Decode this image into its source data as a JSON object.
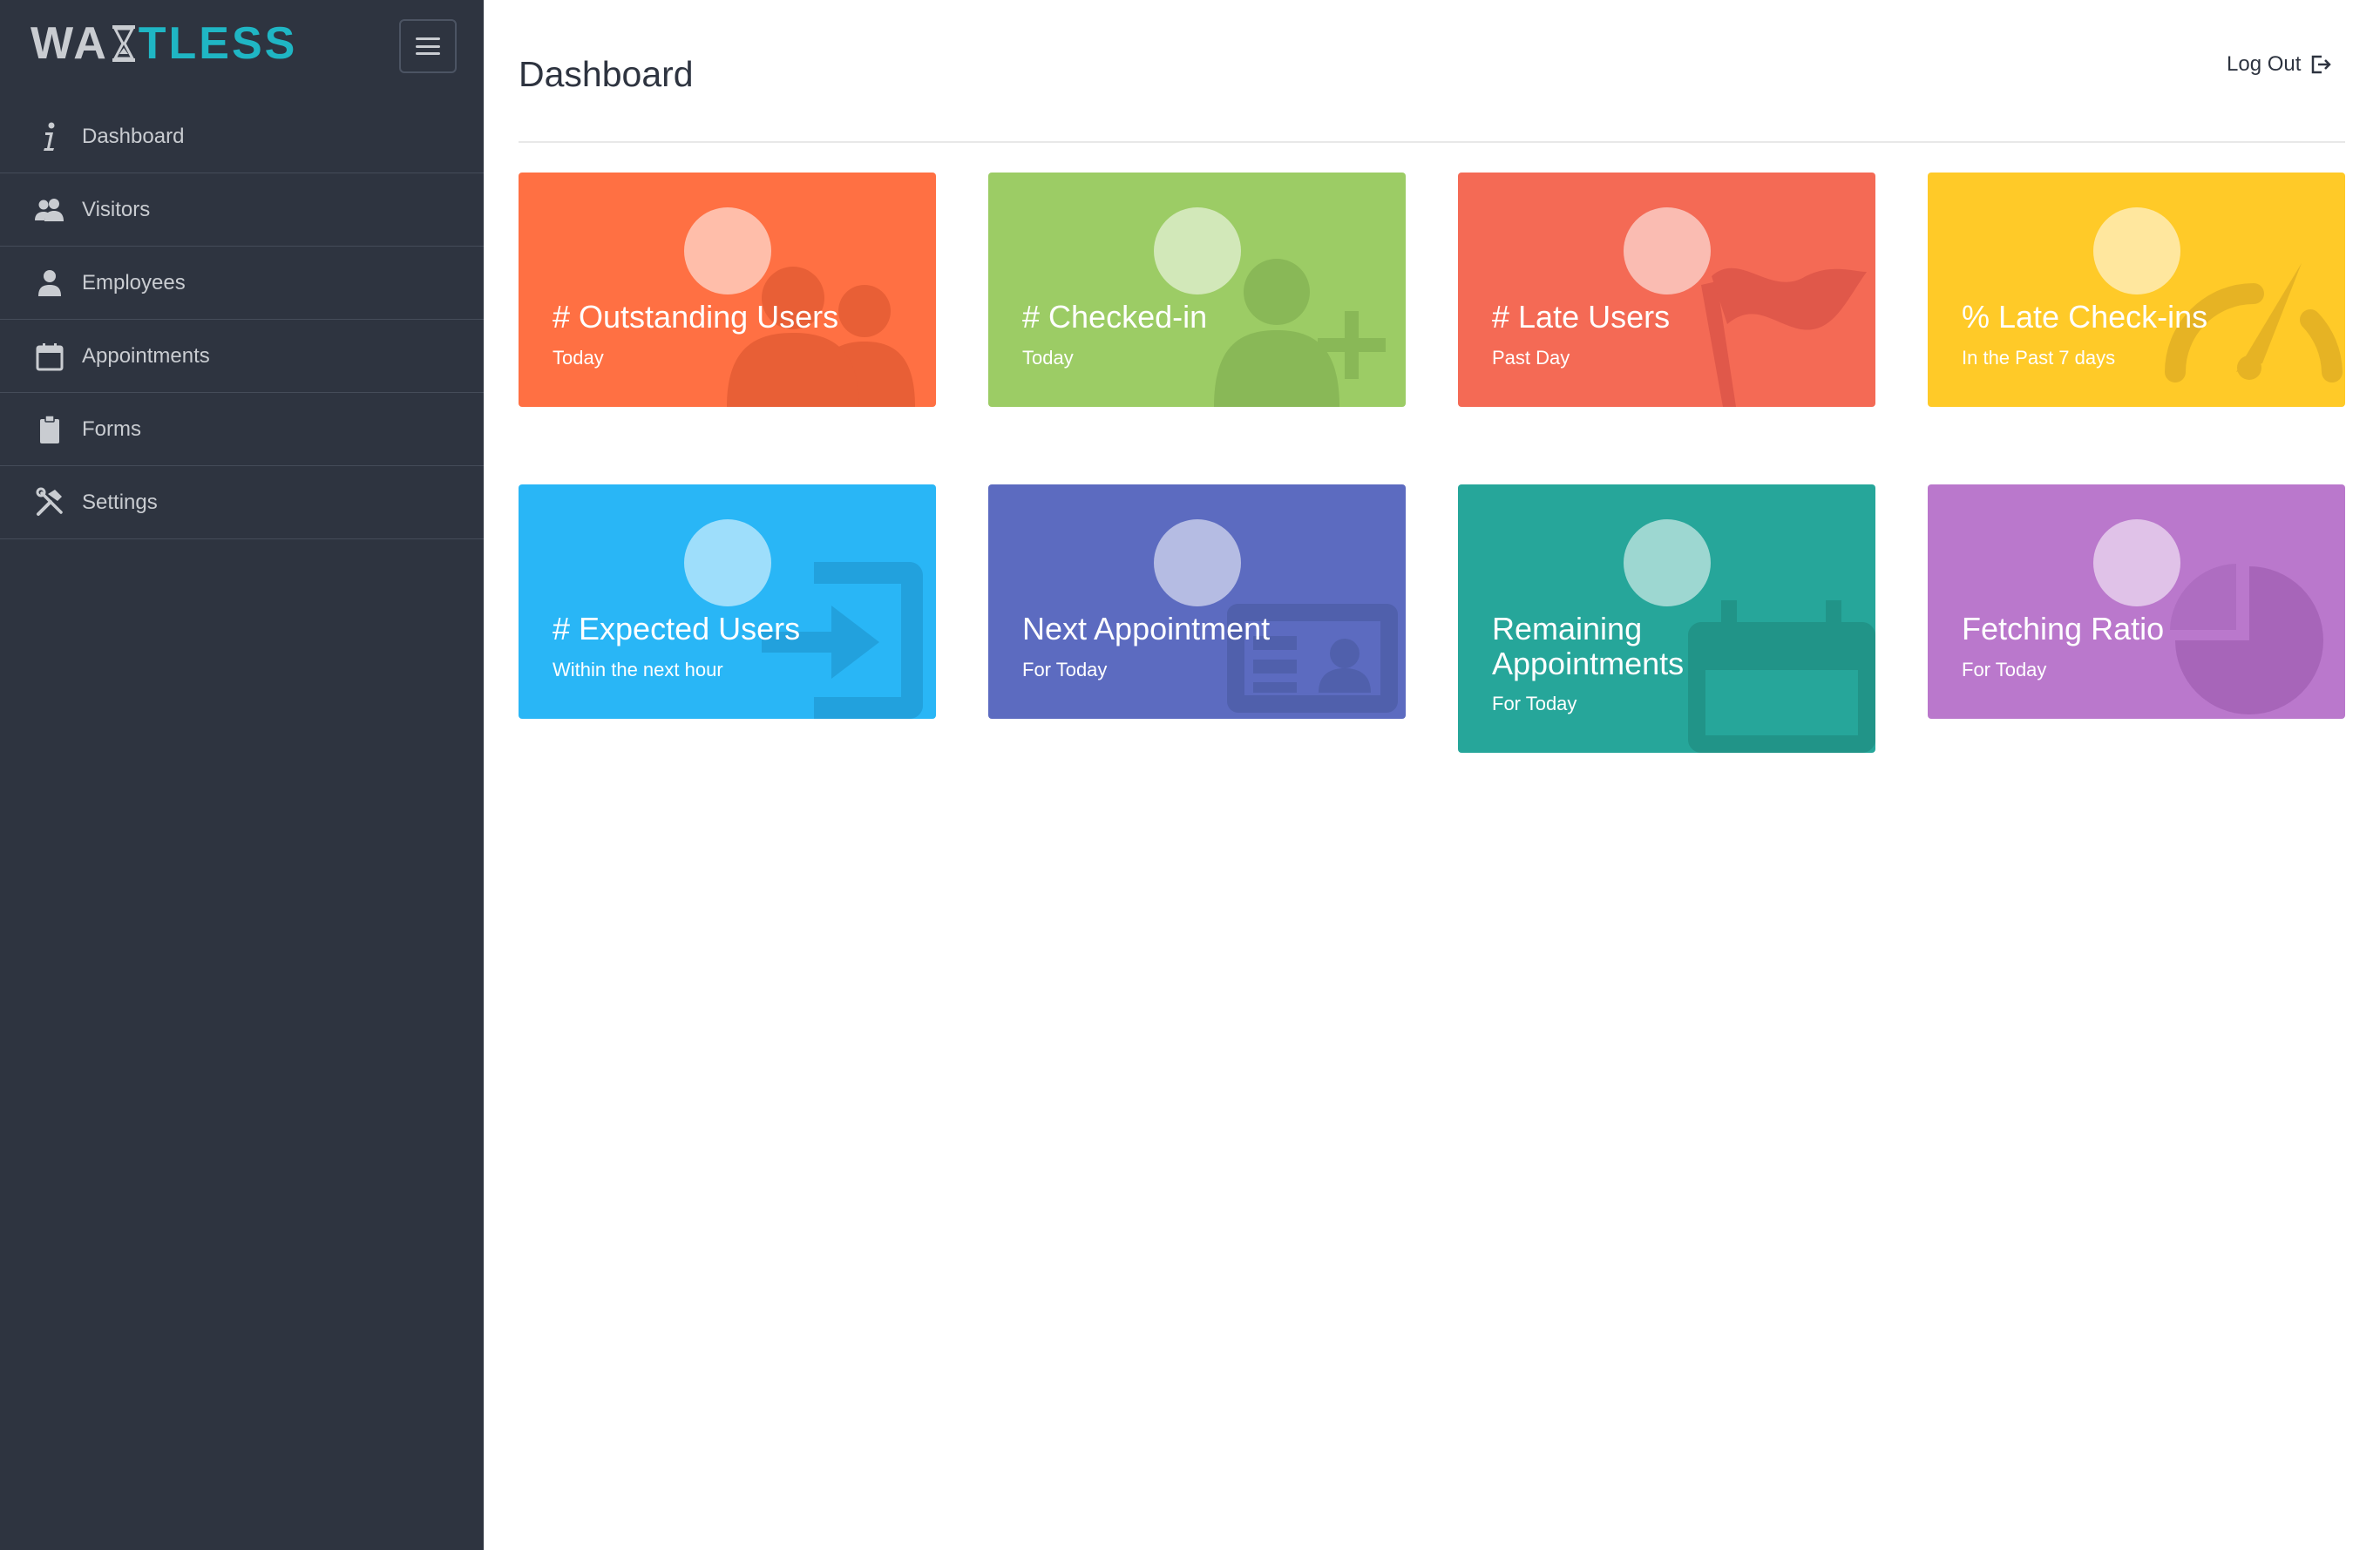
{
  "app": {
    "logo_part1": "WA",
    "logo_part2": "TLESS"
  },
  "sidebar": {
    "items": [
      {
        "label": "Dashboard",
        "icon": "info-icon"
      },
      {
        "label": "Visitors",
        "icon": "users-icon"
      },
      {
        "label": "Employees",
        "icon": "user-icon"
      },
      {
        "label": "Appointments",
        "icon": "calendar-icon"
      },
      {
        "label": "Forms",
        "icon": "clipboard-icon"
      },
      {
        "label": "Settings",
        "icon": "tools-icon"
      }
    ]
  },
  "header": {
    "title": "Dashboard",
    "logout_label": "Log Out"
  },
  "cards": [
    {
      "title": "# Outstanding Users",
      "subtitle": "Today",
      "color": "#ff7043",
      "icon": "users-silhouette-icon"
    },
    {
      "title": "# Checked-in",
      "subtitle": "Today",
      "color": "#9ccc65",
      "icon": "user-add-icon"
    },
    {
      "title": "# Late Users",
      "subtitle": "Past Day",
      "color": "#f46a55",
      "icon": "flag-icon"
    },
    {
      "title": "% Late Check-ins",
      "subtitle": "In the Past 7 days",
      "color": "#ffca28",
      "icon": "gauge-icon"
    },
    {
      "title": "# Expected Users",
      "subtitle": "Within the next hour",
      "color": "#29b6f6",
      "icon": "sign-in-icon"
    },
    {
      "title": "Next Appointment",
      "subtitle": "For Today",
      "color": "#5c6bc0",
      "icon": "id-card-icon"
    },
    {
      "title": "Remaining Appointments",
      "subtitle": "For Today",
      "color": "#26a69a",
      "icon": "calendar-icon"
    },
    {
      "title": "Fetching Ratio",
      "subtitle": "For Today",
      "color": "#ba78cc",
      "icon": "pie-chart-icon"
    }
  ]
}
